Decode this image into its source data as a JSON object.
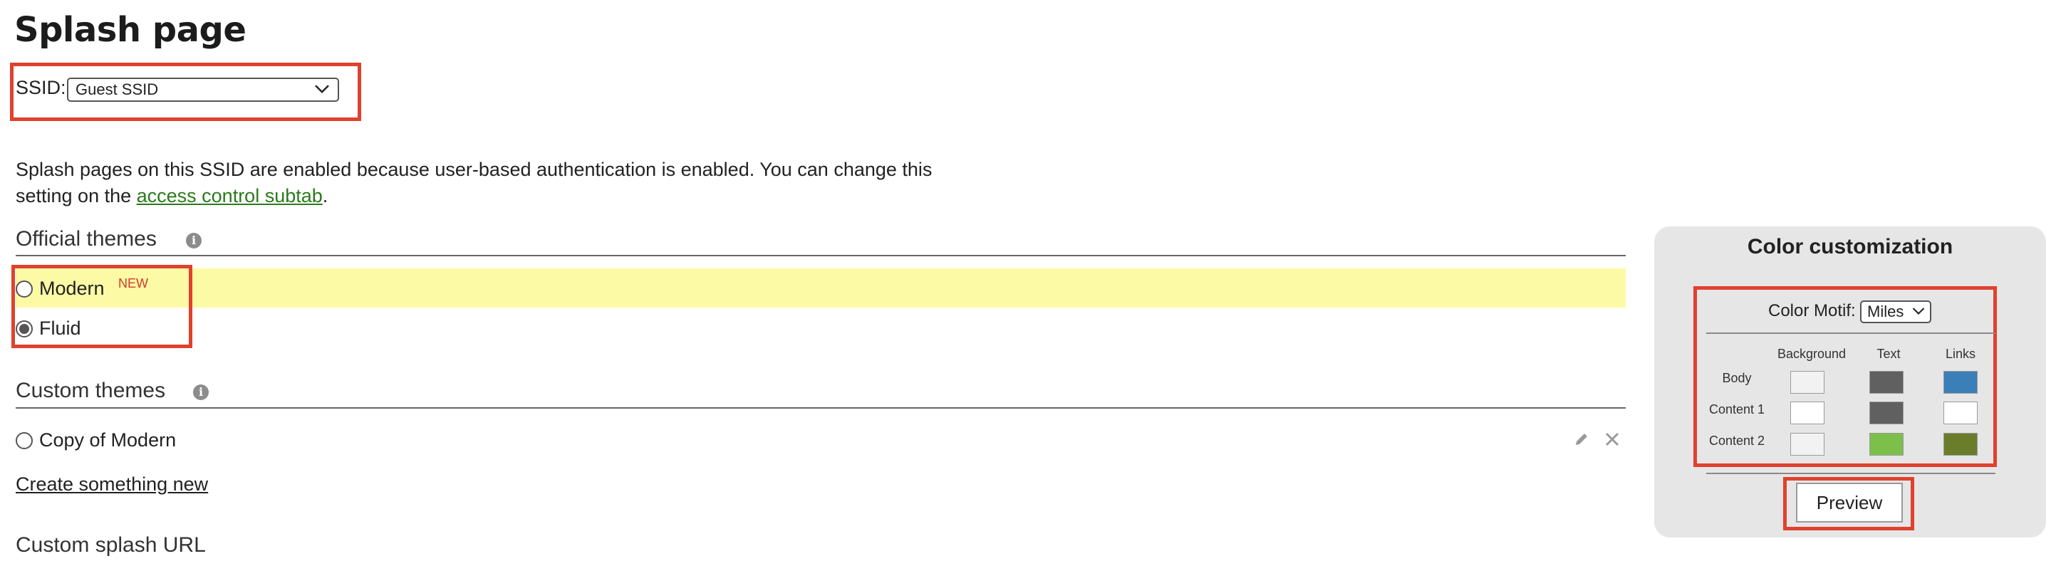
{
  "page": {
    "title": "Splash page"
  },
  "ssid": {
    "label": "SSID:",
    "selected": "Guest SSID"
  },
  "description": {
    "text_before": "Splash pages on this SSID are enabled because user-based authentication is enabled. You can change this setting on the ",
    "link_text": "access control subtab",
    "text_after": "."
  },
  "official_themes": {
    "title": "Official themes",
    "options": [
      {
        "label": "Modern",
        "badge": "NEW",
        "checked": false
      },
      {
        "label": "Fluid",
        "checked": true
      }
    ]
  },
  "custom_themes": {
    "title": "Custom themes",
    "items": [
      {
        "label": "Copy of Modern",
        "checked": false
      }
    ],
    "create_link": "Create something new"
  },
  "custom_splash": {
    "title": "Custom splash URL"
  },
  "color_panel": {
    "title": "Color customization",
    "motif_label": "Color Motif:",
    "motif_value": "Miles",
    "columns": [
      "Background",
      "Text",
      "Links"
    ],
    "rows": [
      {
        "label": "Body",
        "colors": [
          "#f2f2f2",
          "#606060",
          "#3a7fb8"
        ]
      },
      {
        "label": "Content 1",
        "colors": [
          "#ffffff",
          "#606060",
          "#ffffff"
        ]
      },
      {
        "label": "Content 2",
        "colors": [
          "#f2f2f2",
          "#7cc04b",
          "#6a7d2a"
        ]
      }
    ],
    "preview_label": "Preview"
  },
  "colors": {
    "highlight": "#fdfaa6",
    "link": "#2b7a1c",
    "annotation": "#e0412e",
    "badge": "#d23a2a"
  },
  "icons": [
    "chevron-down-icon",
    "info-icon",
    "pencil-icon",
    "close-icon"
  ]
}
